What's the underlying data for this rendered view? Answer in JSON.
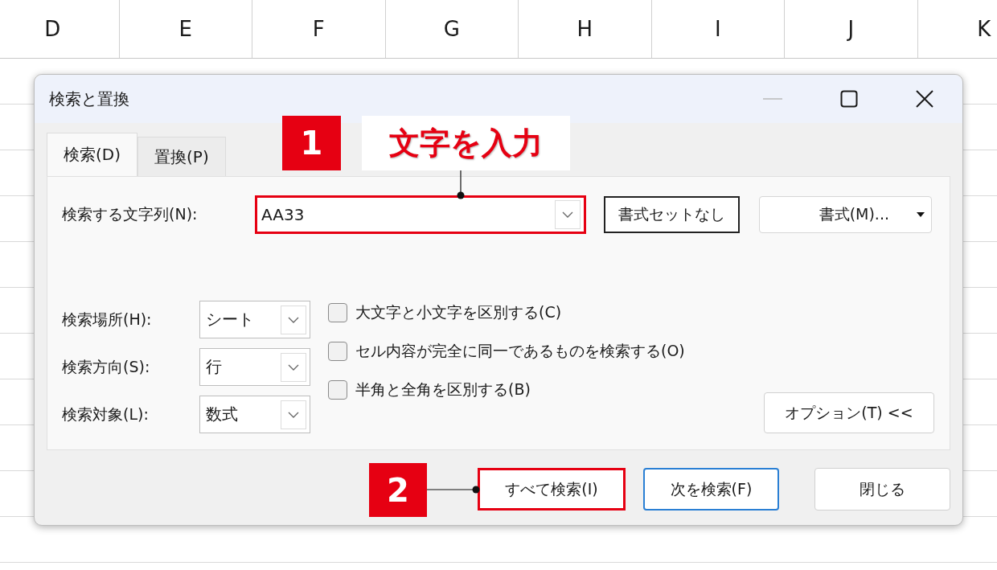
{
  "sheet": {
    "columns": [
      "D",
      "E",
      "F",
      "G",
      "H",
      "I",
      "J",
      "K"
    ]
  },
  "dialog": {
    "title": "検索と置換",
    "tabs": [
      {
        "label": "検索(D)",
        "selected": true
      },
      {
        "label": "置換(P)",
        "selected": false
      }
    ],
    "find": {
      "label": "検索する文字列(N):",
      "value": "AA33",
      "highlighted": true
    },
    "format_buttons": [
      {
        "label": "書式セットなし",
        "kind": "plain"
      },
      {
        "label": "書式(M)...",
        "kind": "menu"
      }
    ],
    "selects": [
      {
        "label": "検索場所(H):",
        "value": "シート"
      },
      {
        "label": "検索方向(S):",
        "value": "行"
      },
      {
        "label": "検索対象(L):",
        "value": "数式"
      }
    ],
    "options": [
      {
        "label": "大文字と小文字を区別する(C)",
        "checked": false
      },
      {
        "label": "セル内容が完全に同一であるものを検索する(O)",
        "checked": false
      },
      {
        "label": "半角と全角を区別する(B)",
        "checked": false
      }
    ],
    "options_button": "オプション(T) <<",
    "buttons": [
      {
        "label": "すべて検索(I)",
        "highlighted": true,
        "default": false
      },
      {
        "label": "次を検索(F)",
        "highlighted": false,
        "default": true
      },
      {
        "label": "閉じる",
        "highlighted": false,
        "default": false
      }
    ]
  },
  "annotations": [
    {
      "number": "1",
      "text": "文字を入力"
    },
    {
      "number": "2"
    }
  ]
}
